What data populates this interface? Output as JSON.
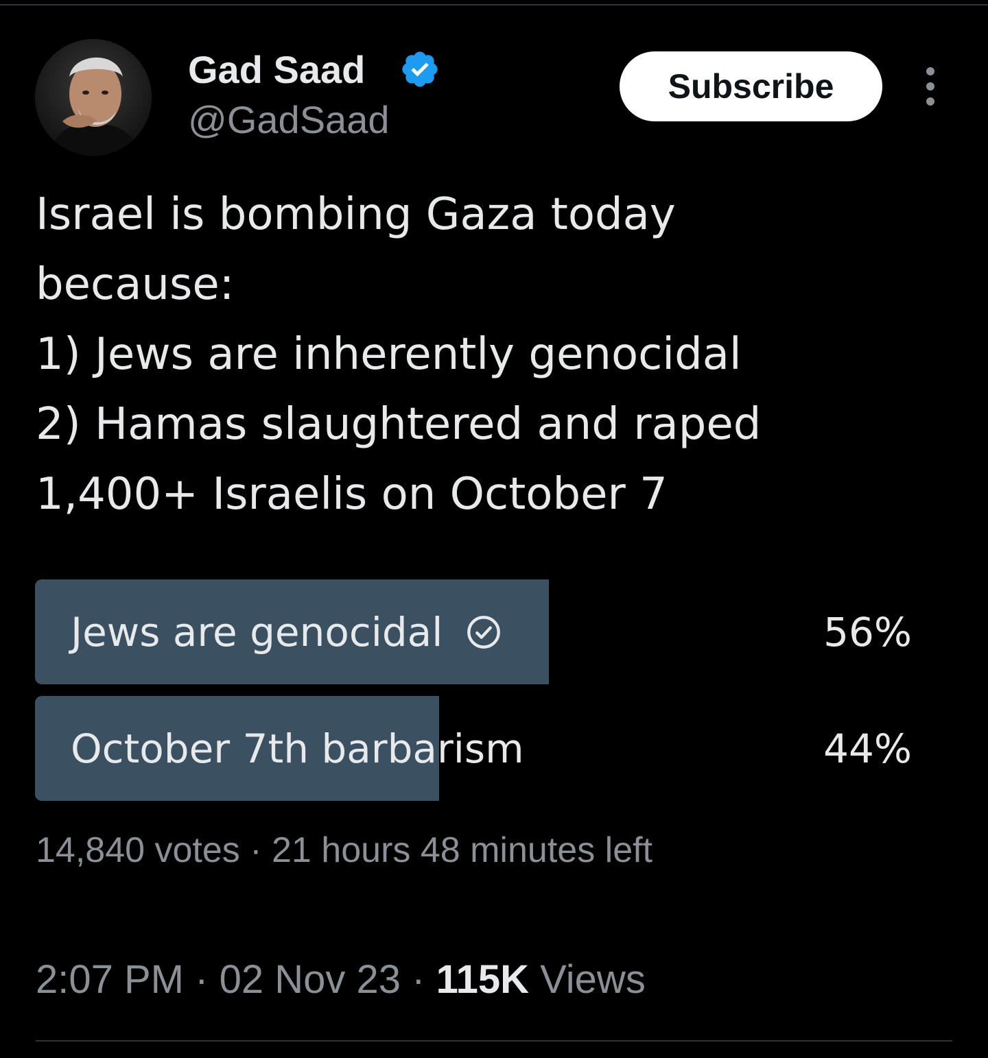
{
  "author": {
    "display_name": "Gad Saad",
    "handle": "@GadSaad",
    "verified": true
  },
  "header": {
    "subscribe_label": "Subscribe"
  },
  "tweet": {
    "text": "Israel is bombing Gaza today\nbecause:\n1) Jews are inherently genocidal\n2) Hamas slaughtered and raped\n1,400+ Israelis on October 7"
  },
  "poll": {
    "options": [
      {
        "label": "Jews are genocidal",
        "percent_label": "56%",
        "percent": 56,
        "selected": true
      },
      {
        "label": "October 7th barbarism",
        "percent_label": "44%",
        "percent": 44,
        "selected": false
      }
    ],
    "votes": "14,840 votes",
    "separator": "·",
    "time_left": "21 hours 48 minutes left"
  },
  "meta": {
    "time": "2:07 PM",
    "date": "02 Nov 23",
    "views_count": "115K",
    "views_label": "Views",
    "separator": "·"
  },
  "colors": {
    "background": "#000000",
    "text_primary": "#e7e9ea",
    "text_secondary": "#8b9096",
    "poll_bar": "#3b5162",
    "verified_badge": "#1d9bf0",
    "divider": "#2f3336"
  },
  "icons": {
    "verified": "verified-badge-icon",
    "more": "more-vertical-icon",
    "selected": "check-circle-icon"
  }
}
